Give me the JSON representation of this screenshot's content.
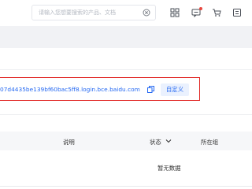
{
  "header": {
    "search": {
      "placeholder": "请输入您想要搜索的产品、文档"
    },
    "icons": [
      "grid-apps-icon",
      "message-icon",
      "cart-icon",
      "billing-icon"
    ],
    "notification_color": "#e8473f"
  },
  "domain_panel": {
    "domain": "07d4435be139bf60bac5ff8.login.bce.baidu.com",
    "custom_button": "自定义",
    "highlight_color": "#e0221f",
    "link_color": "#2468f2"
  },
  "table": {
    "columns": {
      "description": "说明",
      "status": "状态",
      "group": "所在组"
    },
    "empty_text": "暂无数据"
  }
}
